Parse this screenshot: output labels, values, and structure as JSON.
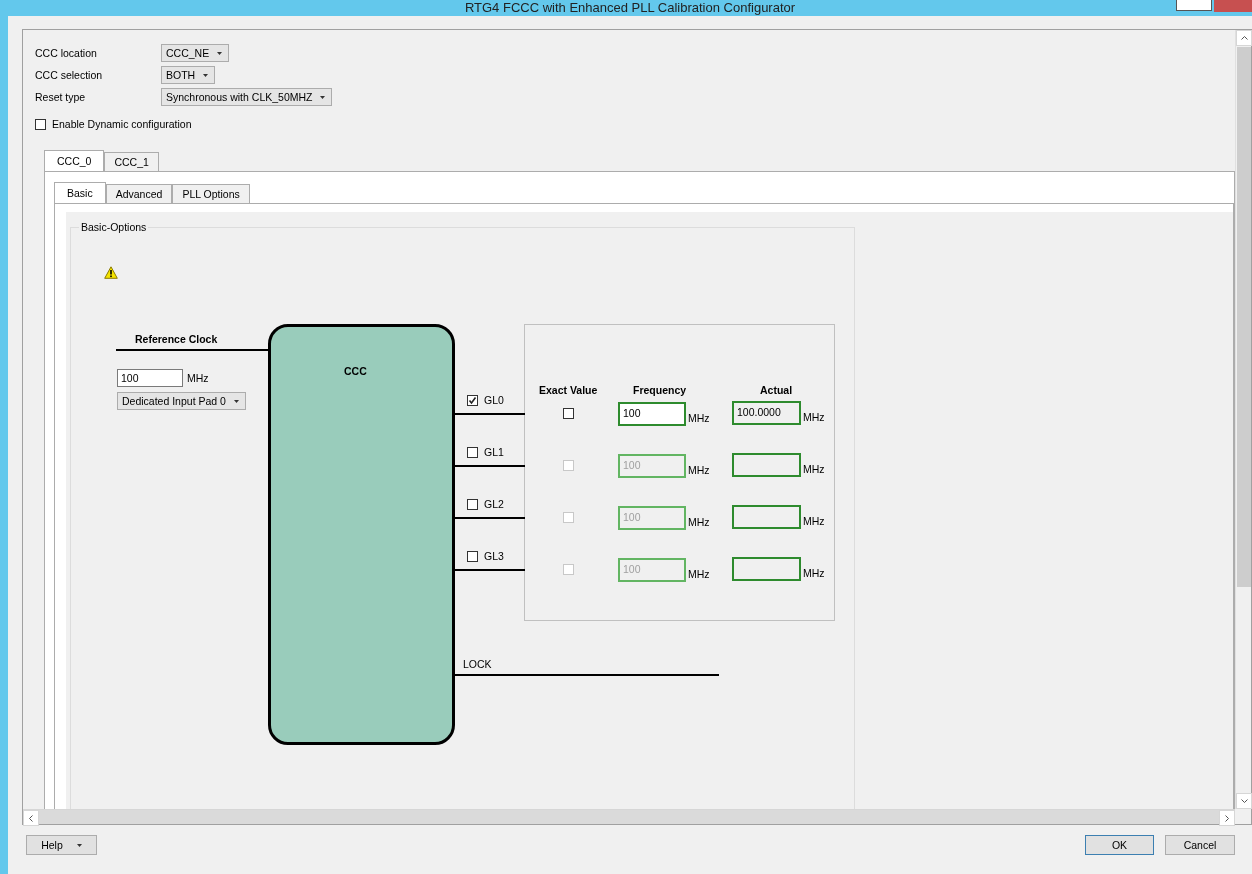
{
  "window": {
    "title": "RTG4 FCCC with Enhanced PLL Calibration Configurator"
  },
  "settings": [
    {
      "label": "CCC  location",
      "value": "CCC_NE"
    },
    {
      "label": "CCC selection",
      "value": "BOTH"
    },
    {
      "label": "Reset type",
      "value": "Synchronous with CLK_50MHZ"
    }
  ],
  "enable_dynamic": {
    "label": "Enable Dynamic configuration",
    "checked": false
  },
  "ccc_tabs": [
    {
      "label": "CCC_0",
      "selected": true
    },
    {
      "label": "CCC_1",
      "selected": false
    }
  ],
  "sub_tabs": [
    {
      "label": "Basic",
      "selected": true
    },
    {
      "label": "Advanced",
      "selected": false
    },
    {
      "label": "PLL Options",
      "selected": false
    }
  ],
  "basic_options": {
    "title": "Basic-Options",
    "reference_clock": {
      "label": "Reference Clock",
      "value": "100",
      "unit": "MHz",
      "source": "Dedicated Input Pad 0"
    },
    "block_label": "CCC",
    "outputs_header": {
      "exact": "Exact Value",
      "frequency": "Frequency",
      "actual": "Actual"
    },
    "outputs": [
      {
        "name": "GL0",
        "checked": true,
        "exact_checked": false,
        "disabled": false,
        "frequency": "100",
        "frequency_unit": "MHz",
        "actual": "100.0000",
        "actual_unit": "MHz"
      },
      {
        "name": "GL1",
        "checked": false,
        "exact_checked": false,
        "disabled": true,
        "frequency": "100",
        "frequency_unit": "MHz",
        "actual_unit": "MHz"
      },
      {
        "name": "GL2",
        "checked": false,
        "exact_checked": false,
        "disabled": true,
        "frequency": "100",
        "frequency_unit": "MHz",
        "actual_unit": "MHz"
      },
      {
        "name": "GL3",
        "checked": false,
        "exact_checked": false,
        "disabled": true,
        "frequency": "100",
        "frequency_unit": "MHz",
        "actual_unit": "MHz"
      }
    ],
    "lock_label": "LOCK"
  },
  "buttons": {
    "help": "Help",
    "ok": "OK",
    "cancel": "Cancel"
  }
}
